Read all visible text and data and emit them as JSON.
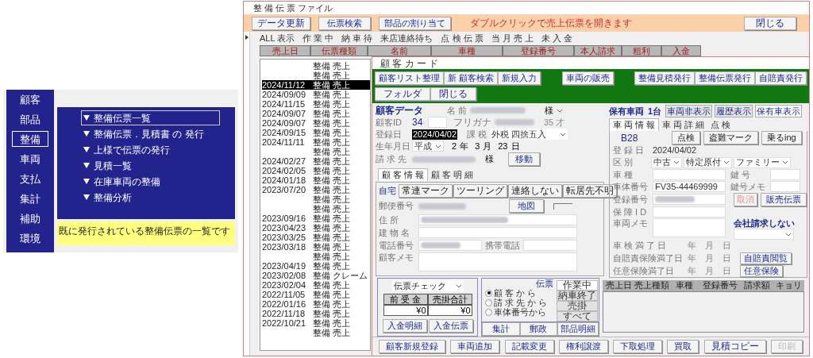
{
  "menu": {
    "nav": [
      {
        "label": "顧客",
        "selected": false
      },
      {
        "label": "部品",
        "selected": false
      },
      {
        "label": "整備",
        "selected": true
      },
      {
        "label": "車両",
        "selected": false
      },
      {
        "label": "支払",
        "selected": false
      },
      {
        "label": "集計",
        "selected": false
      },
      {
        "label": "補助",
        "selected": false
      },
      {
        "label": "環境",
        "selected": false
      }
    ],
    "items": [
      {
        "label": "整備伝票一覧",
        "selected": true
      },
      {
        "label": "整備伝票．見積書 の 発行",
        "selected": false
      },
      {
        "label": "上様で伝票の発行",
        "selected": false
      },
      {
        "label": "見積一覧",
        "selected": false
      },
      {
        "label": "在庫車両の整備",
        "selected": false
      },
      {
        "label": "整備分析",
        "selected": false
      }
    ],
    "description": "既に発行されている整備伝票の一覧です"
  },
  "slip_window": {
    "title": "整 備 伝 票 ファイル",
    "toolbar": [
      "データ更新",
      "伝票検索",
      "部品の割り当て"
    ],
    "hint": "ダブルクリックで売上伝票を開きます",
    "close": "閉じる",
    "filters": [
      "ALL 表示",
      "作 業 中",
      "納 車 待",
      "来店連絡待ち",
      "点 検 伝 票",
      "当 月 売 上",
      "未 入 金"
    ],
    "columns": [
      "売上日",
      "伝票種類",
      "名前",
      "車種",
      "登録番号",
      "本人請求",
      "粗利",
      "入金"
    ],
    "rows": [
      {
        "date": "",
        "type": "整備 売上",
        "selected": false
      },
      {
        "date": "",
        "type": "整備 売上",
        "selected": false
      },
      {
        "date": "2024/11/12",
        "type": "整備 売上",
        "selected": true
      },
      {
        "date": "2024/09/09",
        "type": "整備 売上",
        "selected": false
      },
      {
        "date": "2024/11/15",
        "type": "整備 売上",
        "selected": false
      },
      {
        "date": "2024/09/07",
        "type": "整備 売上",
        "selected": false
      },
      {
        "date": "2024/09/07",
        "type": "整備 売上",
        "selected": false
      },
      {
        "date": "2024/09/15",
        "type": "整備 売上",
        "selected": false
      },
      {
        "date": "2024/11/11",
        "type": "整備 売上",
        "selected": false
      },
      {
        "date": "",
        "type": "整備 売上",
        "selected": false
      },
      {
        "date": "2024/02/27",
        "type": "整備 売上",
        "selected": false
      },
      {
        "date": "2024/02/05",
        "type": "整備 売上",
        "selected": false
      },
      {
        "date": "2024/01/18",
        "type": "整備 売上",
        "selected": false
      },
      {
        "date": "2023/07/20",
        "type": "整備 売上",
        "selected": false
      },
      {
        "date": "",
        "type": "整備 売上",
        "selected": false
      },
      {
        "date": "",
        "type": "整備 売上",
        "selected": false
      },
      {
        "date": "2023/09/16",
        "type": "整備 売上",
        "selected": false
      },
      {
        "date": "2023/04/23",
        "type": "整備 売上",
        "selected": false
      },
      {
        "date": "2023/03/25",
        "type": "整備 売上",
        "selected": false
      },
      {
        "date": "2023/03/18",
        "type": "整備 売上",
        "selected": false
      },
      {
        "date": "",
        "type": "整備 売上",
        "selected": false
      },
      {
        "date": "2023/04/19",
        "type": "整備 売上",
        "selected": false
      },
      {
        "date": "2023/02/08",
        "type": "整備 クレーム",
        "selected": false
      },
      {
        "date": "2023/02/04",
        "type": "整備 売上",
        "selected": false
      },
      {
        "date": "2022/11/05",
        "type": "整備 売上",
        "selected": false
      },
      {
        "date": "2022/01/16",
        "type": "整備 売上",
        "selected": false
      },
      {
        "date": "2022/11/18",
        "type": "整備 売上",
        "selected": false
      },
      {
        "date": "2022/10/21",
        "type": "整備 売上",
        "selected": false
      },
      {
        "date": "",
        "type": "整備 売上",
        "selected": false
      }
    ]
  },
  "customer_card": {
    "title": "顧 客 カ ー ド",
    "toolbar": [
      [
        "顧客リスト整理",
        "新 顧客検索",
        "新規入力"
      ],
      [
        "車両の販売"
      ],
      [
        "整備見積発行",
        "整備伝票発行",
        "自賠責発行"
      ],
      [
        "フォルダ",
        "閉じる"
      ]
    ],
    "customer": {
      "heading": "顧客データ",
      "id_label": "顧客ID",
      "id": "34",
      "name_label": "名 前",
      "honorific": "様",
      "furigana_label": "フリガナ",
      "age": "35",
      "age_unit": "才",
      "registered_label": "登録日",
      "registered": "2024/04/02",
      "birth_label": "生年月日",
      "era": "平成",
      "birth_year": "2",
      "year_unit": "年",
      "birth_month": "3",
      "month_unit": "月",
      "birth_day": "23",
      "day_unit": "日",
      "tax_label": "課 税",
      "tax": "外税 四捨五入",
      "billing_label": "請 求 先",
      "billing_honorific": "様",
      "move_button": "移動"
    },
    "customer_tabs": [
      {
        "label": "顧 客 情 報",
        "selected": true
      },
      {
        "label": "顧 客 明 細",
        "selected": false
      }
    ],
    "home": {
      "label": "自宅",
      "marks": [
        "常連マーク",
        "ツーリング",
        "連絡しない",
        "転居先不明"
      ],
      "postal_label": "郵便番号",
      "map_button": "地図",
      "address_label": "住 所",
      "building_label": "建 物 名",
      "phone_label": "電話番号",
      "mobile_label": "携帯電話",
      "memo_label": "顧客メモ"
    },
    "vehicles": {
      "label": "保有車両",
      "count": "1台",
      "view_tabs": [
        {
          "label": "車両非表示",
          "selected": false
        },
        {
          "label": "履歴表示",
          "selected": false
        },
        {
          "label": "保有車表示",
          "selected": true
        }
      ],
      "tabs": [
        {
          "label": "車 両 情 報",
          "selected": true
        },
        {
          "label": "車 両 詳 細",
          "selected": false
        },
        {
          "label": "点 検",
          "selected": false
        }
      ],
      "code": "B28",
      "registered_label": "登 録 日",
      "registered": "2024/04/02",
      "actions": [
        "点検",
        "盗難マーク",
        "乗るing"
      ],
      "category_label": "区 別",
      "categories": [
        "中古",
        "特定原付",
        "ファミリー"
      ],
      "model_label": "車 種",
      "key_label": "鍵 号",
      "frame_label": "車体番号",
      "frame": "FV35-44469999",
      "key_memo_label": "鍵号メモ",
      "plate_label": "登録番号",
      "warranty_label": "保 障 I D",
      "memo_label": "車両メモ",
      "cancel": {
        "label": "取消",
        "disabled": true
      },
      "sales_slip": "販売伝票",
      "billing_note": "会社請求しない",
      "expiries": [
        {
          "label": "車 検 満 了 日",
          "year_unit": "年",
          "month_unit": "月",
          "day_unit": "日"
        },
        {
          "label": "自賠責保険満了日",
          "year_unit": "年",
          "month_unit": "月",
          "day_unit": "日",
          "button": "自賠責閲覧"
        },
        {
          "label": "任意保険満了日",
          "year_unit": "年",
          "month_unit": "月",
          "day_unit": "日",
          "button": "任意保険"
        }
      ]
    },
    "slip_check": {
      "select": "伝票チェック",
      "columns": [
        "前 受 金",
        "売掛合計"
      ],
      "values": [
        "¥0",
        "¥0"
      ],
      "buttons": [
        "入金明細",
        "入金伝票"
      ]
    },
    "slip_filter": {
      "label": "伝票",
      "radios": [
        {
          "label": "顧 客 か ら",
          "selected": true
        },
        {
          "label": "請 求 先 か ら",
          "selected": false
        },
        {
          "label": "車体番号から",
          "selected": false
        }
      ],
      "statuses": [
        {
          "label": "作業中",
          "selected": true
        },
        {
          "label": "納車終了",
          "selected": false
        },
        {
          "label": "売掛",
          "selected": false
        },
        {
          "label": "すべて",
          "selected": false
        }
      ],
      "buttons": [
        "集計",
        "郵政",
        "部品明細"
      ]
    },
    "history_columns": [
      "売上日",
      "売上種類",
      "車種",
      "登録番号",
      "請求額",
      "キョリ"
    ],
    "footer_buttons": [
      {
        "label": "顧客新規登録",
        "disabled": false
      },
      {
        "label": "車両追加",
        "disabled": false
      },
      {
        "label": "記載変更",
        "disabled": false
      },
      {
        "label": "権利譲渡",
        "disabled": false
      },
      {
        "label": "下取処理",
        "disabled": false
      },
      {
        "label": "買取",
        "disabled": false
      },
      {
        "label": "見積コピー",
        "disabled": false
      },
      {
        "label": "印刷",
        "disabled": true
      }
    ]
  }
}
